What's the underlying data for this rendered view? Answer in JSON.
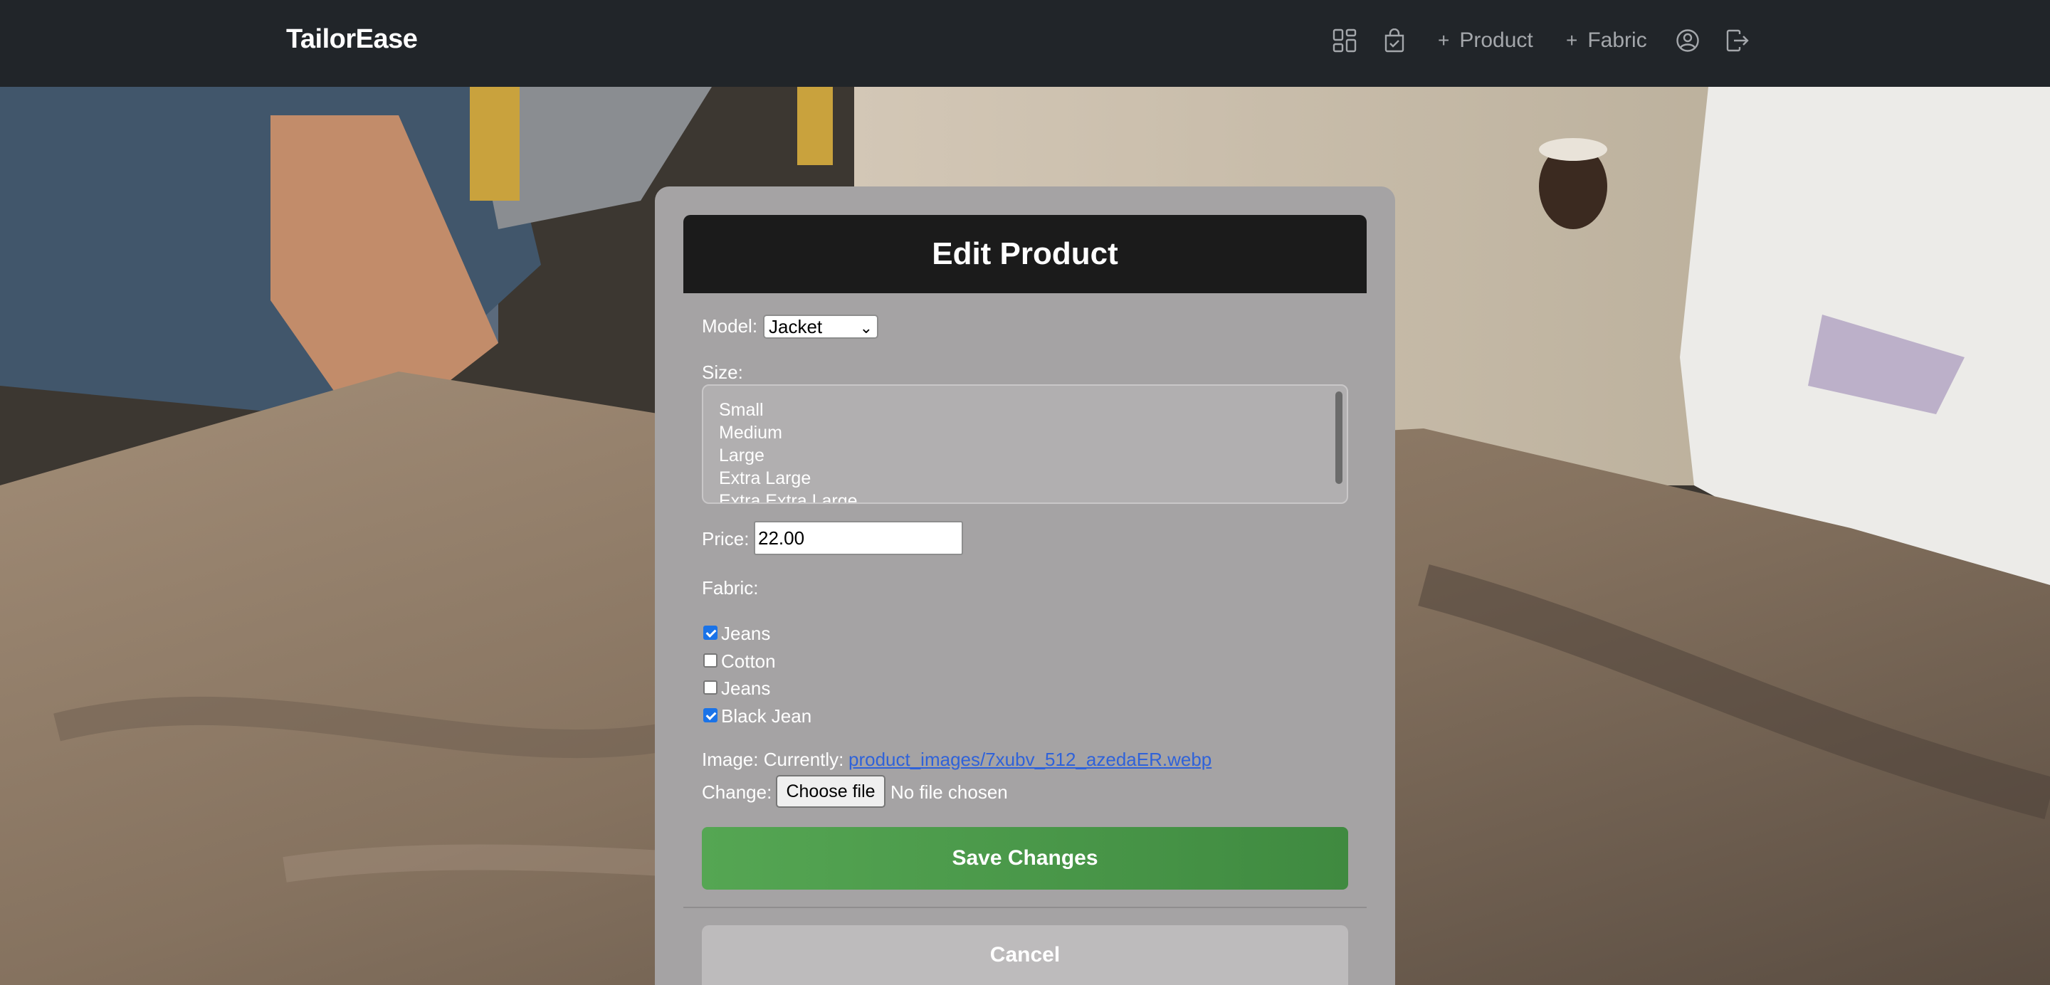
{
  "navbar": {
    "brand": "TailorEase",
    "add_product_label": "Product",
    "add_fabric_label": "Fabric",
    "plus_glyph": "+"
  },
  "form": {
    "title": "Edit Product",
    "model_label": "Model:",
    "model_value": "Jacket",
    "size_label": "Size:",
    "size_options": [
      "Small",
      "Medium",
      "Large",
      "Extra Large",
      "Extra Extra Large"
    ],
    "price_label": "Price:",
    "price_value": "22.00",
    "fabric_label": "Fabric:",
    "fabrics": [
      {
        "label": "Jeans",
        "checked": true
      },
      {
        "label": "Cotton",
        "checked": false
      },
      {
        "label": "Jeans",
        "checked": false
      },
      {
        "label": "Black Jean",
        "checked": true
      }
    ],
    "image_label": "Image: Currently:",
    "image_link": "product_images/7xubv_512_azedaER.webp",
    "change_label": "Change:",
    "choose_file_label": "Choose file",
    "file_status": "No file chosen",
    "save_label": "Save Changes",
    "cancel_label": "Cancel"
  },
  "icons": {
    "dashboard": "dashboard-grid-icon",
    "orders": "bag-check-icon",
    "profile": "person-circle-icon",
    "logout": "box-arrow-right-icon"
  },
  "colors": {
    "navbar_bg": "#212529",
    "card_bg": "#a5a3a4",
    "header_bg": "#1b1b1b",
    "save_green": "#4a9a49",
    "link_blue": "#2f62d9"
  }
}
